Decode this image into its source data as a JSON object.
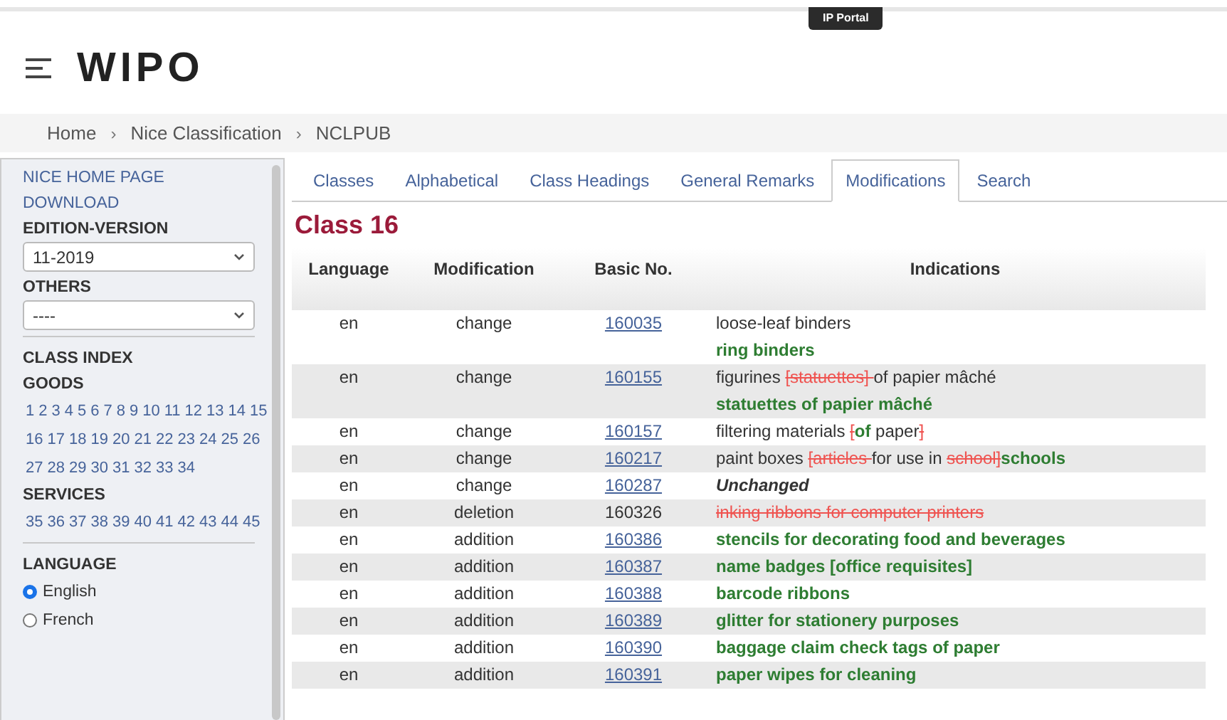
{
  "top_bar": {
    "badge": "IP Portal"
  },
  "header": {
    "logo": "WIPO"
  },
  "breadcrumb": [
    "Home",
    "Nice Classification",
    "NCLPUB"
  ],
  "breadcrumb_separator": "›",
  "sidebar": {
    "links": [
      "NICE HOME PAGE",
      "DOWNLOAD"
    ],
    "edition_label": "EDITION-VERSION",
    "edition_value": "11-2019",
    "others_label": "OTHERS",
    "others_value": "----",
    "class_index_label": "CLASS INDEX",
    "goods_label": "GOODS",
    "goods": [
      "1",
      "2",
      "3",
      "4",
      "5",
      "6",
      "7",
      "8",
      "9",
      "10",
      "11",
      "12",
      "13",
      "14",
      "15",
      "16",
      "17",
      "18",
      "19",
      "20",
      "21",
      "22",
      "23",
      "24",
      "25",
      "26",
      "27",
      "28",
      "29",
      "30",
      "31",
      "32",
      "33",
      "34"
    ],
    "services_label": "SERVICES",
    "services": [
      "35",
      "36",
      "37",
      "38",
      "39",
      "40",
      "41",
      "42",
      "43",
      "44",
      "45"
    ],
    "language_label": "LANGUAGE",
    "languages": [
      {
        "label": "English",
        "selected": true
      },
      {
        "label": "French",
        "selected": false
      }
    ]
  },
  "tabs": [
    {
      "label": "Classes",
      "selected": false
    },
    {
      "label": "Alphabetical",
      "selected": false
    },
    {
      "label": "Class Headings",
      "selected": false
    },
    {
      "label": "General Remarks",
      "selected": false
    },
    {
      "label": "Modifications",
      "selected": true
    },
    {
      "label": "Search",
      "selected": false
    }
  ],
  "title": "Class 16",
  "table": {
    "columns": [
      "Language",
      "Modification",
      "Basic No.",
      "Indications"
    ],
    "rows": [
      {
        "language": "en",
        "modification": "change",
        "basic_no": "160035",
        "linked": true,
        "lines": [
          [
            {
              "kind": "plain",
              "text": "loose-leaf binders"
            }
          ],
          [
            {
              "kind": "added",
              "text": "ring binders"
            }
          ]
        ]
      },
      {
        "language": "en",
        "modification": "change",
        "basic_no": "160155",
        "linked": true,
        "lines": [
          [
            {
              "kind": "plain",
              "text": "figurines "
            },
            {
              "kind": "deleted",
              "text": "[statuettes] "
            },
            {
              "kind": "plain",
              "text": "of papier mâché"
            }
          ],
          [
            {
              "kind": "added",
              "text": "statuettes of papier mâché"
            }
          ]
        ]
      },
      {
        "language": "en",
        "modification": "change",
        "basic_no": "160157",
        "linked": true,
        "lines": [
          [
            {
              "kind": "plain",
              "text": "filtering materials "
            },
            {
              "kind": "deleted",
              "text": "["
            },
            {
              "kind": "added",
              "text": "of"
            },
            {
              "kind": "plain",
              "text": " paper"
            },
            {
              "kind": "deleted",
              "text": "]"
            }
          ]
        ]
      },
      {
        "language": "en",
        "modification": "change",
        "basic_no": "160217",
        "linked": true,
        "lines": [
          [
            {
              "kind": "plain",
              "text": "paint boxes "
            },
            {
              "kind": "deleted",
              "text": "[articles "
            },
            {
              "kind": "plain",
              "text": "for use in "
            },
            {
              "kind": "deleted",
              "text": "school]"
            },
            {
              "kind": "added",
              "text": "schools"
            }
          ]
        ]
      },
      {
        "language": "en",
        "modification": "change",
        "basic_no": "160287",
        "linked": true,
        "lines": [
          [
            {
              "kind": "unchanged",
              "text": "Unchanged"
            }
          ]
        ]
      },
      {
        "language": "en",
        "modification": "deletion",
        "basic_no": "160326",
        "linked": false,
        "lines": [
          [
            {
              "kind": "deleted",
              "text": "inking ribbons for computer printers"
            }
          ]
        ]
      },
      {
        "language": "en",
        "modification": "addition",
        "basic_no": "160386",
        "linked": true,
        "lines": [
          [
            {
              "kind": "added",
              "text": "stencils for decorating food and beverages"
            }
          ]
        ]
      },
      {
        "language": "en",
        "modification": "addition",
        "basic_no": "160387",
        "linked": true,
        "lines": [
          [
            {
              "kind": "added",
              "text": "name badges [office requisites]"
            }
          ]
        ]
      },
      {
        "language": "en",
        "modification": "addition",
        "basic_no": "160388",
        "linked": true,
        "lines": [
          [
            {
              "kind": "added",
              "text": "barcode ribbons"
            }
          ]
        ]
      },
      {
        "language": "en",
        "modification": "addition",
        "basic_no": "160389",
        "linked": true,
        "lines": [
          [
            {
              "kind": "added",
              "text": "glitter for stationery purposes"
            }
          ]
        ]
      },
      {
        "language": "en",
        "modification": "addition",
        "basic_no": "160390",
        "linked": true,
        "lines": [
          [
            {
              "kind": "added",
              "text": "baggage claim check tags of paper"
            }
          ]
        ]
      },
      {
        "language": "en",
        "modification": "addition",
        "basic_no": "160391",
        "linked": true,
        "lines": [
          [
            {
              "kind": "added",
              "text": "paper wipes for cleaning"
            }
          ]
        ]
      }
    ]
  }
}
